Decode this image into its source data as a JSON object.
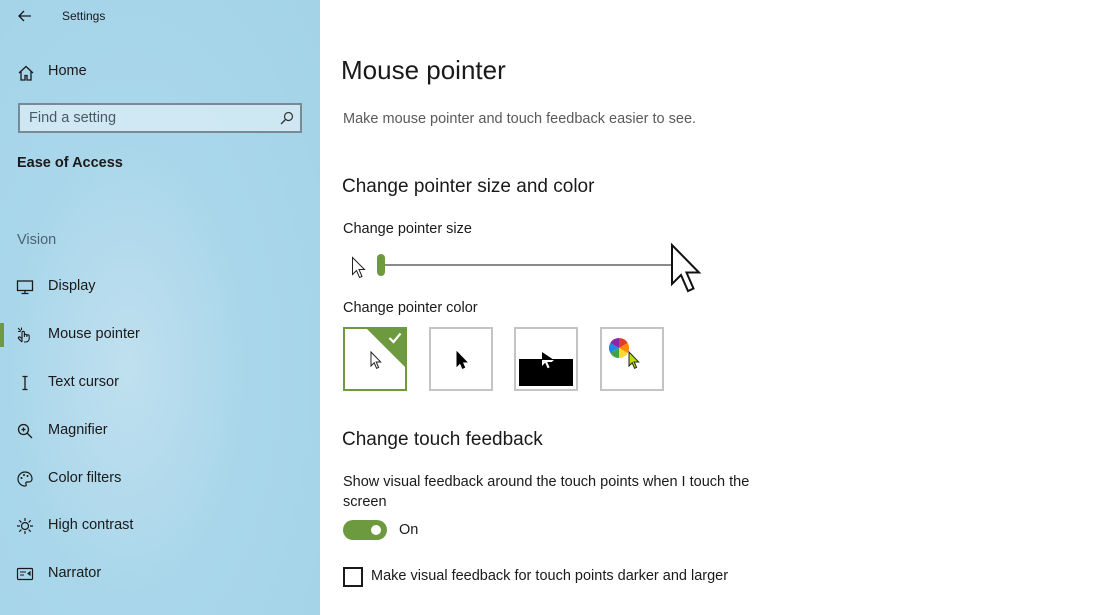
{
  "window": {
    "title": "Settings"
  },
  "sidebar": {
    "home_label": "Home",
    "search_placeholder": "Find a setting",
    "category": "Ease of Access",
    "group_label": "Vision",
    "items": [
      {
        "label": "Display",
        "icon": "monitor-icon"
      },
      {
        "label": "Mouse pointer",
        "icon": "mouse-pointer-icon",
        "active": true
      },
      {
        "label": "Text cursor",
        "icon": "text-cursor-icon"
      },
      {
        "label": "Magnifier",
        "icon": "magnifier-icon"
      },
      {
        "label": "Color filters",
        "icon": "palette-icon"
      },
      {
        "label": "High contrast",
        "icon": "brightness-icon"
      },
      {
        "label": "Narrator",
        "icon": "narrator-icon"
      }
    ]
  },
  "main": {
    "title": "Mouse pointer",
    "description": "Make mouse pointer and touch feedback easier to see.",
    "pointer_section": {
      "heading": "Change pointer size and color",
      "size_label": "Change pointer size",
      "size_value_fraction": 0.0,
      "color_label": "Change pointer color",
      "color_options": [
        "white-pointer",
        "black-pointer",
        "inverted-pointer",
        "custom-color-pointer"
      ],
      "selected_color_index": 0
    },
    "touch_section": {
      "heading": "Change touch feedback",
      "feedback_line1": "Show visual feedback around the touch points when I touch the",
      "feedback_line2": "screen",
      "toggle_state": "On",
      "darker_label": "Make visual feedback for touch points darker and larger",
      "darker_checked": false
    }
  },
  "colors": {
    "accent": "#6d9a3e",
    "sidebar_bg": "#a9d6ea"
  }
}
